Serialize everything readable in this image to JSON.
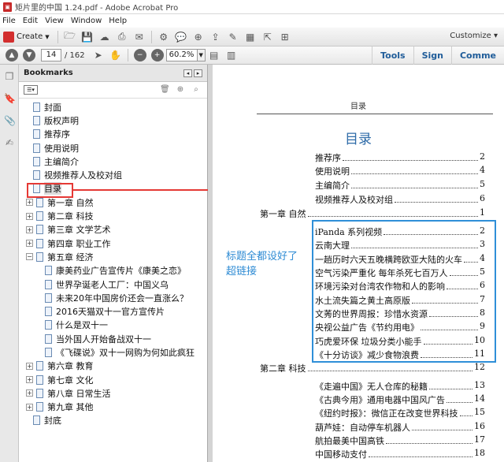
{
  "window": {
    "title": "矩片里的中国 1.24.pdf - Adobe Acrobat Pro"
  },
  "menu": [
    "File",
    "Edit",
    "View",
    "Window",
    "Help"
  ],
  "toolbar": {
    "create_label": "Create",
    "customize_label": "Customize"
  },
  "nav": {
    "current_page": "14",
    "total_pages": "/ 162",
    "zoom": "60.2%"
  },
  "right_links": [
    "Tools",
    "Sign",
    "Comme"
  ],
  "bookmarks": {
    "title": "Bookmarks",
    "items": [
      {
        "label": "封面",
        "indent": 1,
        "expander": ""
      },
      {
        "label": "版权声明",
        "indent": 1,
        "expander": ""
      },
      {
        "label": "推荐序",
        "indent": 1,
        "expander": ""
      },
      {
        "label": "使用说明",
        "indent": 1,
        "expander": ""
      },
      {
        "label": "主编简介",
        "indent": 1,
        "expander": ""
      },
      {
        "label": "视频推荐人及校对组",
        "indent": 1,
        "expander": ""
      },
      {
        "label": "目录",
        "indent": 1,
        "expander": "",
        "selected": true
      },
      {
        "label": "第一章 自然",
        "indent": 0,
        "expander": "+"
      },
      {
        "label": "第二章 科技",
        "indent": 0,
        "expander": "+"
      },
      {
        "label": "第三章 文学艺术",
        "indent": 0,
        "expander": "+"
      },
      {
        "label": "第四章 职业工作",
        "indent": 0,
        "expander": "+"
      },
      {
        "label": "第五章 经济",
        "indent": 0,
        "expander": "−"
      },
      {
        "label": "康美药业广告宣传片《康美之恋》",
        "indent": 2,
        "expander": ""
      },
      {
        "label": "世界孕诞老人工厂：中国义乌",
        "indent": 2,
        "expander": ""
      },
      {
        "label": "未来20年中国房价还会一直涨么？",
        "indent": 2,
        "expander": ""
      },
      {
        "label": "2016天猫双十一官方宣传片",
        "indent": 2,
        "expander": ""
      },
      {
        "label": "什么是双十一",
        "indent": 2,
        "expander": ""
      },
      {
        "label": "当外国人开始备战双十一",
        "indent": 2,
        "expander": ""
      },
      {
        "label": "《飞碟说》双十一网购为何如此疯狂",
        "indent": 2,
        "expander": ""
      },
      {
        "label": "第六章 教育",
        "indent": 0,
        "expander": "+"
      },
      {
        "label": "第七章 文化",
        "indent": 0,
        "expander": "+"
      },
      {
        "label": "第八章 日常生活",
        "indent": 0,
        "expander": "+"
      },
      {
        "label": "第九章 其他",
        "indent": 0,
        "expander": "+"
      },
      {
        "label": "封底",
        "indent": 1,
        "expander": ""
      }
    ]
  },
  "document": {
    "running_head": "目录",
    "toc_title": "目录",
    "annotation": "标题全都设好了超链接",
    "entries": [
      {
        "text": "推荐序",
        "page": "2",
        "level": 1
      },
      {
        "text": "使用说明",
        "page": "4",
        "level": 1
      },
      {
        "text": "主编简介",
        "page": "5",
        "level": 1
      },
      {
        "text": "视频推荐人及校对组",
        "page": "6",
        "level": 1
      },
      {
        "text": "第一章 自然",
        "page": "1",
        "level": 0
      },
      {
        "text": "iPanda 系列视频",
        "page": "2",
        "level": 1
      },
      {
        "text": "云南大理",
        "page": "3",
        "level": 1
      },
      {
        "text": "一趟历时六天五晚横跨欧亚大陆的火车",
        "page": "4",
        "level": 1
      },
      {
        "text": "空气污染严重化 每年杀死七百万人",
        "page": "5",
        "level": 1
      },
      {
        "text": "环境污染对台湾农作物和人的影响",
        "page": "6",
        "level": 1
      },
      {
        "text": "水土流失篇之黄土高原版",
        "page": "7",
        "level": 1
      },
      {
        "text": "文莠的世界周报：珍惜水资源",
        "page": "8",
        "level": 1
      },
      {
        "text": "央视公益广告《节约用电》",
        "page": "9",
        "level": 1
      },
      {
        "text": "巧虎爱环保 垃圾分类小能手",
        "page": "10",
        "level": 1
      },
      {
        "text": "《十分访谈》减少食物浪费",
        "page": "11",
        "level": 1
      },
      {
        "text": "第二章 科技",
        "page": "12",
        "level": 0
      },
      {
        "text": "《走遍中国》无人仓库的秘籍",
        "page": "13",
        "level": 1
      },
      {
        "text": "《古典今用》通用电器中国风广告",
        "page": "14",
        "level": 1
      },
      {
        "text": "《纽约时报》：微信正在改变世界科技",
        "page": "15",
        "level": 1
      },
      {
        "text": "葫芦娃：自动停车机器人",
        "page": "16",
        "level": 1
      },
      {
        "text": "航拍最美中国高铁",
        "page": "17",
        "level": 1
      },
      {
        "text": "中国移动支付",
        "page": "18",
        "level": 1
      }
    ]
  },
  "colors": {
    "accent": "#2e6ba8",
    "highlight_red": "#e53935",
    "annotation_blue": "#2e8bd4"
  }
}
